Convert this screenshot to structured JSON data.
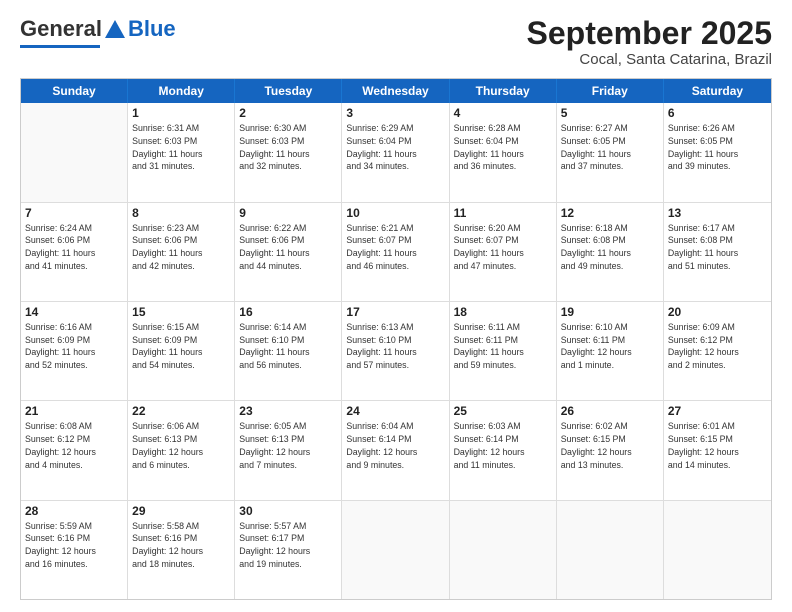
{
  "header": {
    "logo_general": "General",
    "logo_blue": "Blue",
    "month_title": "September 2025",
    "subtitle": "Cocal, Santa Catarina, Brazil"
  },
  "weekdays": [
    "Sunday",
    "Monday",
    "Tuesday",
    "Wednesday",
    "Thursday",
    "Friday",
    "Saturday"
  ],
  "rows": [
    [
      {
        "day": "",
        "info": ""
      },
      {
        "day": "1",
        "info": "Sunrise: 6:31 AM\nSunset: 6:03 PM\nDaylight: 11 hours\nand 31 minutes."
      },
      {
        "day": "2",
        "info": "Sunrise: 6:30 AM\nSunset: 6:03 PM\nDaylight: 11 hours\nand 32 minutes."
      },
      {
        "day": "3",
        "info": "Sunrise: 6:29 AM\nSunset: 6:04 PM\nDaylight: 11 hours\nand 34 minutes."
      },
      {
        "day": "4",
        "info": "Sunrise: 6:28 AM\nSunset: 6:04 PM\nDaylight: 11 hours\nand 36 minutes."
      },
      {
        "day": "5",
        "info": "Sunrise: 6:27 AM\nSunset: 6:05 PM\nDaylight: 11 hours\nand 37 minutes."
      },
      {
        "day": "6",
        "info": "Sunrise: 6:26 AM\nSunset: 6:05 PM\nDaylight: 11 hours\nand 39 minutes."
      }
    ],
    [
      {
        "day": "7",
        "info": "Sunrise: 6:24 AM\nSunset: 6:06 PM\nDaylight: 11 hours\nand 41 minutes."
      },
      {
        "day": "8",
        "info": "Sunrise: 6:23 AM\nSunset: 6:06 PM\nDaylight: 11 hours\nand 42 minutes."
      },
      {
        "day": "9",
        "info": "Sunrise: 6:22 AM\nSunset: 6:06 PM\nDaylight: 11 hours\nand 44 minutes."
      },
      {
        "day": "10",
        "info": "Sunrise: 6:21 AM\nSunset: 6:07 PM\nDaylight: 11 hours\nand 46 minutes."
      },
      {
        "day": "11",
        "info": "Sunrise: 6:20 AM\nSunset: 6:07 PM\nDaylight: 11 hours\nand 47 minutes."
      },
      {
        "day": "12",
        "info": "Sunrise: 6:18 AM\nSunset: 6:08 PM\nDaylight: 11 hours\nand 49 minutes."
      },
      {
        "day": "13",
        "info": "Sunrise: 6:17 AM\nSunset: 6:08 PM\nDaylight: 11 hours\nand 51 minutes."
      }
    ],
    [
      {
        "day": "14",
        "info": "Sunrise: 6:16 AM\nSunset: 6:09 PM\nDaylight: 11 hours\nand 52 minutes."
      },
      {
        "day": "15",
        "info": "Sunrise: 6:15 AM\nSunset: 6:09 PM\nDaylight: 11 hours\nand 54 minutes."
      },
      {
        "day": "16",
        "info": "Sunrise: 6:14 AM\nSunset: 6:10 PM\nDaylight: 11 hours\nand 56 minutes."
      },
      {
        "day": "17",
        "info": "Sunrise: 6:13 AM\nSunset: 6:10 PM\nDaylight: 11 hours\nand 57 minutes."
      },
      {
        "day": "18",
        "info": "Sunrise: 6:11 AM\nSunset: 6:11 PM\nDaylight: 11 hours\nand 59 minutes."
      },
      {
        "day": "19",
        "info": "Sunrise: 6:10 AM\nSunset: 6:11 PM\nDaylight: 12 hours\nand 1 minute."
      },
      {
        "day": "20",
        "info": "Sunrise: 6:09 AM\nSunset: 6:12 PM\nDaylight: 12 hours\nand 2 minutes."
      }
    ],
    [
      {
        "day": "21",
        "info": "Sunrise: 6:08 AM\nSunset: 6:12 PM\nDaylight: 12 hours\nand 4 minutes."
      },
      {
        "day": "22",
        "info": "Sunrise: 6:06 AM\nSunset: 6:13 PM\nDaylight: 12 hours\nand 6 minutes."
      },
      {
        "day": "23",
        "info": "Sunrise: 6:05 AM\nSunset: 6:13 PM\nDaylight: 12 hours\nand 7 minutes."
      },
      {
        "day": "24",
        "info": "Sunrise: 6:04 AM\nSunset: 6:14 PM\nDaylight: 12 hours\nand 9 minutes."
      },
      {
        "day": "25",
        "info": "Sunrise: 6:03 AM\nSunset: 6:14 PM\nDaylight: 12 hours\nand 11 minutes."
      },
      {
        "day": "26",
        "info": "Sunrise: 6:02 AM\nSunset: 6:15 PM\nDaylight: 12 hours\nand 13 minutes."
      },
      {
        "day": "27",
        "info": "Sunrise: 6:01 AM\nSunset: 6:15 PM\nDaylight: 12 hours\nand 14 minutes."
      }
    ],
    [
      {
        "day": "28",
        "info": "Sunrise: 5:59 AM\nSunset: 6:16 PM\nDaylight: 12 hours\nand 16 minutes."
      },
      {
        "day": "29",
        "info": "Sunrise: 5:58 AM\nSunset: 6:16 PM\nDaylight: 12 hours\nand 18 minutes."
      },
      {
        "day": "30",
        "info": "Sunrise: 5:57 AM\nSunset: 6:17 PM\nDaylight: 12 hours\nand 19 minutes."
      },
      {
        "day": "",
        "info": ""
      },
      {
        "day": "",
        "info": ""
      },
      {
        "day": "",
        "info": ""
      },
      {
        "day": "",
        "info": ""
      }
    ]
  ]
}
